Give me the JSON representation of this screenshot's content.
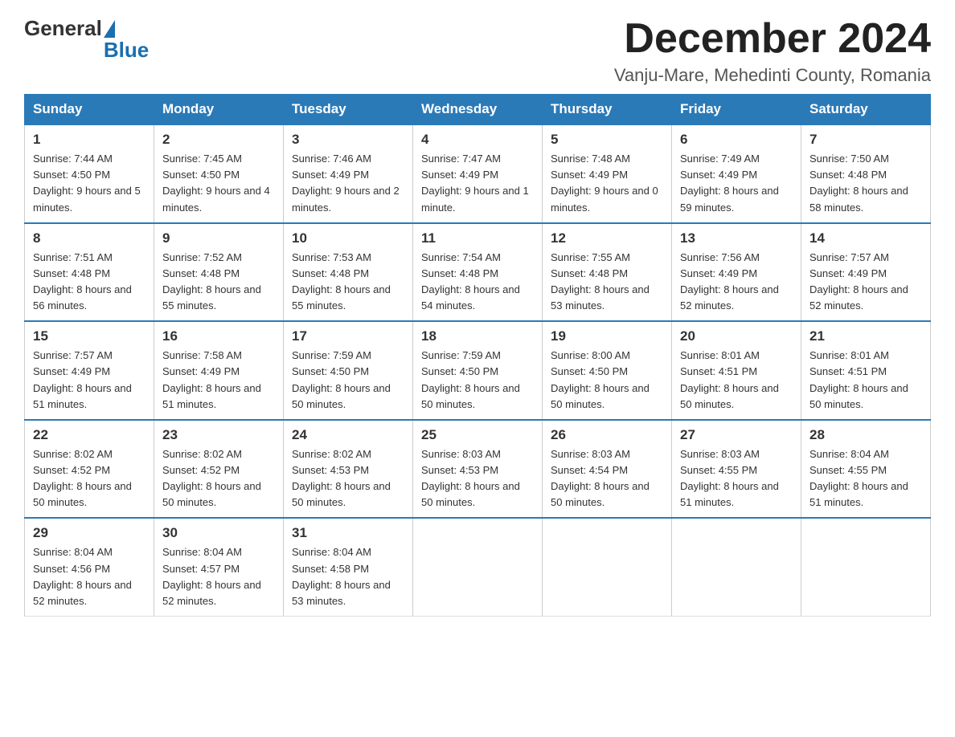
{
  "header": {
    "logo_general": "General",
    "logo_blue": "Blue",
    "title": "December 2024",
    "subtitle": "Vanju-Mare, Mehedinti County, Romania"
  },
  "days_of_week": [
    "Sunday",
    "Monday",
    "Tuesday",
    "Wednesday",
    "Thursday",
    "Friday",
    "Saturday"
  ],
  "weeks": [
    [
      {
        "day": "1",
        "sunrise": "7:44 AM",
        "sunset": "4:50 PM",
        "daylight": "9 hours and 5 minutes."
      },
      {
        "day": "2",
        "sunrise": "7:45 AM",
        "sunset": "4:50 PM",
        "daylight": "9 hours and 4 minutes."
      },
      {
        "day": "3",
        "sunrise": "7:46 AM",
        "sunset": "4:49 PM",
        "daylight": "9 hours and 2 minutes."
      },
      {
        "day": "4",
        "sunrise": "7:47 AM",
        "sunset": "4:49 PM",
        "daylight": "9 hours and 1 minute."
      },
      {
        "day": "5",
        "sunrise": "7:48 AM",
        "sunset": "4:49 PM",
        "daylight": "9 hours and 0 minutes."
      },
      {
        "day": "6",
        "sunrise": "7:49 AM",
        "sunset": "4:49 PM",
        "daylight": "8 hours and 59 minutes."
      },
      {
        "day": "7",
        "sunrise": "7:50 AM",
        "sunset": "4:48 PM",
        "daylight": "8 hours and 58 minutes."
      }
    ],
    [
      {
        "day": "8",
        "sunrise": "7:51 AM",
        "sunset": "4:48 PM",
        "daylight": "8 hours and 56 minutes."
      },
      {
        "day": "9",
        "sunrise": "7:52 AM",
        "sunset": "4:48 PM",
        "daylight": "8 hours and 55 minutes."
      },
      {
        "day": "10",
        "sunrise": "7:53 AM",
        "sunset": "4:48 PM",
        "daylight": "8 hours and 55 minutes."
      },
      {
        "day": "11",
        "sunrise": "7:54 AM",
        "sunset": "4:48 PM",
        "daylight": "8 hours and 54 minutes."
      },
      {
        "day": "12",
        "sunrise": "7:55 AM",
        "sunset": "4:48 PM",
        "daylight": "8 hours and 53 minutes."
      },
      {
        "day": "13",
        "sunrise": "7:56 AM",
        "sunset": "4:49 PM",
        "daylight": "8 hours and 52 minutes."
      },
      {
        "day": "14",
        "sunrise": "7:57 AM",
        "sunset": "4:49 PM",
        "daylight": "8 hours and 52 minutes."
      }
    ],
    [
      {
        "day": "15",
        "sunrise": "7:57 AM",
        "sunset": "4:49 PM",
        "daylight": "8 hours and 51 minutes."
      },
      {
        "day": "16",
        "sunrise": "7:58 AM",
        "sunset": "4:49 PM",
        "daylight": "8 hours and 51 minutes."
      },
      {
        "day": "17",
        "sunrise": "7:59 AM",
        "sunset": "4:50 PM",
        "daylight": "8 hours and 50 minutes."
      },
      {
        "day": "18",
        "sunrise": "7:59 AM",
        "sunset": "4:50 PM",
        "daylight": "8 hours and 50 minutes."
      },
      {
        "day": "19",
        "sunrise": "8:00 AM",
        "sunset": "4:50 PM",
        "daylight": "8 hours and 50 minutes."
      },
      {
        "day": "20",
        "sunrise": "8:01 AM",
        "sunset": "4:51 PM",
        "daylight": "8 hours and 50 minutes."
      },
      {
        "day": "21",
        "sunrise": "8:01 AM",
        "sunset": "4:51 PM",
        "daylight": "8 hours and 50 minutes."
      }
    ],
    [
      {
        "day": "22",
        "sunrise": "8:02 AM",
        "sunset": "4:52 PM",
        "daylight": "8 hours and 50 minutes."
      },
      {
        "day": "23",
        "sunrise": "8:02 AM",
        "sunset": "4:52 PM",
        "daylight": "8 hours and 50 minutes."
      },
      {
        "day": "24",
        "sunrise": "8:02 AM",
        "sunset": "4:53 PM",
        "daylight": "8 hours and 50 minutes."
      },
      {
        "day": "25",
        "sunrise": "8:03 AM",
        "sunset": "4:53 PM",
        "daylight": "8 hours and 50 minutes."
      },
      {
        "day": "26",
        "sunrise": "8:03 AM",
        "sunset": "4:54 PM",
        "daylight": "8 hours and 50 minutes."
      },
      {
        "day": "27",
        "sunrise": "8:03 AM",
        "sunset": "4:55 PM",
        "daylight": "8 hours and 51 minutes."
      },
      {
        "day": "28",
        "sunrise": "8:04 AM",
        "sunset": "4:55 PM",
        "daylight": "8 hours and 51 minutes."
      }
    ],
    [
      {
        "day": "29",
        "sunrise": "8:04 AM",
        "sunset": "4:56 PM",
        "daylight": "8 hours and 52 minutes."
      },
      {
        "day": "30",
        "sunrise": "8:04 AM",
        "sunset": "4:57 PM",
        "daylight": "8 hours and 52 minutes."
      },
      {
        "day": "31",
        "sunrise": "8:04 AM",
        "sunset": "4:58 PM",
        "daylight": "8 hours and 53 minutes."
      },
      null,
      null,
      null,
      null
    ]
  ],
  "labels": {
    "sunrise": "Sunrise:",
    "sunset": "Sunset:",
    "daylight": "Daylight:"
  }
}
